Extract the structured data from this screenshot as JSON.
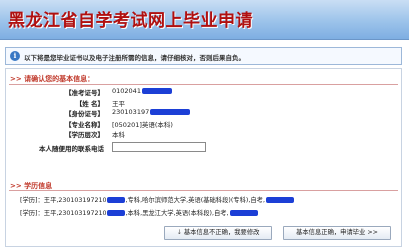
{
  "header": {
    "title": "黑龙江省自学考试网上毕业申请"
  },
  "notice": {
    "icon": "info-icon",
    "text": "以下将是您毕业证书以及电子注册所需的信息，请仔细核对，否则后果自负。"
  },
  "basic_info": {
    "section_title": ">> 请确认您的基本信息：",
    "rows": [
      {
        "label": "【准考证号】",
        "value": "0102041"
      },
      {
        "label": "【姓    名】",
        "value": "王平"
      },
      {
        "label": "【身份证号】",
        "value": "230103197"
      },
      {
        "label": "【专业名称】",
        "value": "[050201]英语(本科)"
      },
      {
        "label": "【学历层次】",
        "value": "本科"
      }
    ],
    "phone_label": "本人随便用的联系电话",
    "phone_value": ""
  },
  "education": {
    "section_title": ">> 学历信息",
    "lines": [
      {
        "prefix": "[学历]：王平,230103197210",
        "rest": ",专科,哈尔滨师范大学,英语(基础科段)(专科),自考,",
        "tail": ""
      },
      {
        "prefix": "[学历]：王平,230103197210",
        "rest": ",本科,黑龙江大学,英语(本科段),自考,",
        "tail": ""
      }
    ]
  },
  "buttons": {
    "wrong": "基本信息不正确，我要修改",
    "correct": "基本信息正确，申请毕业 >>"
  },
  "colors": {
    "redaction": "#1c3fd6",
    "title": "#b01010",
    "section": "#c0392b"
  }
}
